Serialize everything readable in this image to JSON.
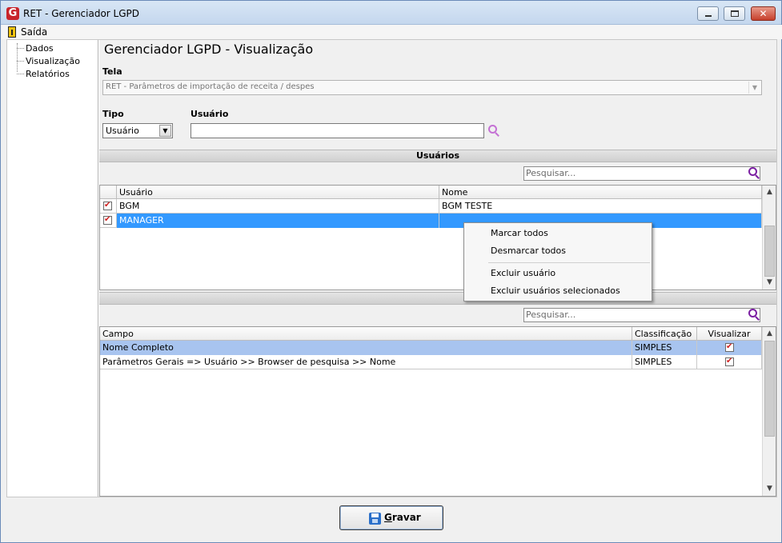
{
  "window": {
    "title": "RET - Gerenciador LGPD",
    "app_icon_letter": "G",
    "close_glyph": "✕"
  },
  "menu": {
    "exit_label": "Saída"
  },
  "tree": {
    "items": [
      "Dados",
      "Visualização",
      "Relatórios"
    ]
  },
  "page": {
    "title": "Gerenciador LGPD - Visualização"
  },
  "form": {
    "tela_label": "Tela",
    "tela_value": "RET - Parâmetros de importação de receita / despes",
    "tipo_label": "Tipo",
    "tipo_value": "Usuário",
    "usuario_label": "Usuário",
    "usuario_value": ""
  },
  "users_section": {
    "title": "Usuários",
    "search_placeholder": "Pesquisar...",
    "columns": [
      "Usuário",
      "Nome"
    ],
    "rows": [
      {
        "checked": true,
        "usuario": "BGM",
        "nome": "BGM TESTE",
        "selected": false
      },
      {
        "checked": true,
        "usuario": "MANAGER",
        "nome": "",
        "selected": true
      }
    ]
  },
  "context_menu": {
    "items": [
      "Marcar todos",
      "Desmarcar todos",
      "Excluir usuário",
      "Excluir usuários selecionados"
    ]
  },
  "fields_section": {
    "search_placeholder": "Pesquisar...",
    "columns": [
      "Campo",
      "Classificação",
      "Visualizar"
    ],
    "rows": [
      {
        "campo": "Nome Completo",
        "classificacao": "SIMPLES",
        "visualizar": true,
        "selected": true
      },
      {
        "campo": "Parâmetros Gerais => Usuário >> Browser de pesquisa >> Nome",
        "classificacao": "SIMPLES",
        "visualizar": true,
        "selected": false
      }
    ]
  },
  "footer": {
    "save_label": "Gravar"
  },
  "colors": {
    "selection_blue": "#3399ff",
    "selection_light": "#a8c4ef",
    "search_icon_purple": "#7b1fa2",
    "search_icon_light": "#c471d4"
  }
}
